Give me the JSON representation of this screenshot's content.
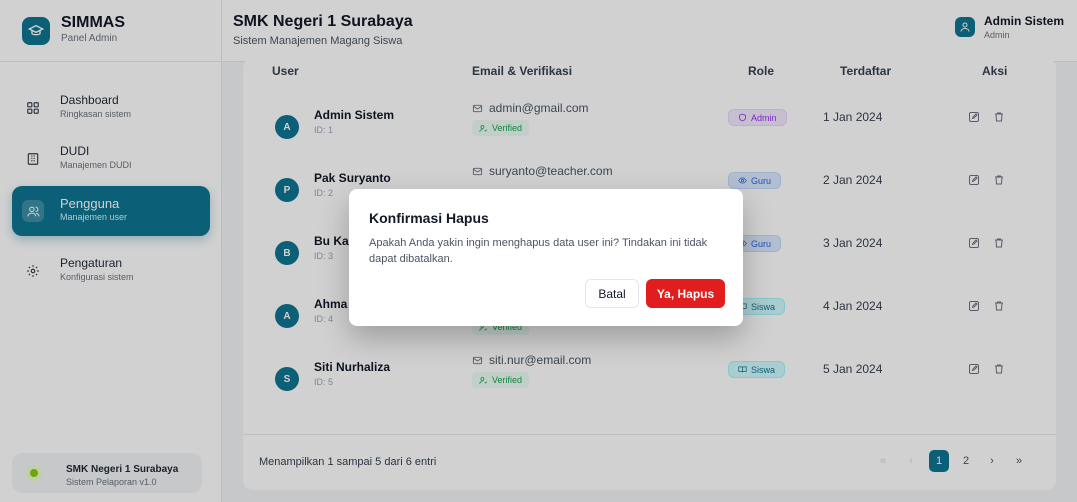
{
  "brand": {
    "title": "SIMMAS",
    "subtitle": "Panel Admin"
  },
  "sidebar": {
    "items": [
      {
        "label": "Dashboard",
        "sub": "Ringkasan sistem",
        "icon": "grid-icon"
      },
      {
        "label": "DUDI",
        "sub": "Manajemen DUDI",
        "icon": "building-icon"
      },
      {
        "label": "Pengguna",
        "sub": "Manajemen user",
        "icon": "users-icon"
      },
      {
        "label": "Pengaturan",
        "sub": "Konfigurasi sistem",
        "icon": "gear-icon"
      }
    ],
    "footer": {
      "title": "SMK Negeri 1 Surabaya",
      "subtitle": "Sistem Pelaporan v1.0"
    }
  },
  "header": {
    "title": "SMK Negeri 1 Surabaya",
    "subtitle": "Sistem Manajemen Magang Siswa",
    "user_name": "Admin Sistem",
    "user_role": "Admin"
  },
  "table": {
    "headers": {
      "user": "User",
      "email": "Email & Verifikasi",
      "role": "Role",
      "registered": "Terdaftar",
      "actions": "Aksi"
    },
    "rows": [
      {
        "initial": "A",
        "name": "Admin Sistem",
        "id": "ID: 1",
        "email": "admin@gmail.com",
        "verified": "Verified",
        "role": "Admin",
        "date": "1 Jan 2024"
      },
      {
        "initial": "P",
        "name": "Pak Suryanto",
        "id": "ID: 2",
        "email": "suryanto@teacher.com",
        "verified": "",
        "role": "Guru",
        "date": "2 Jan 2024"
      },
      {
        "initial": "B",
        "name": "Bu Kar",
        "id": "ID: 3",
        "email": "",
        "verified": "",
        "role": "Guru",
        "date": "3 Jan 2024"
      },
      {
        "initial": "A",
        "name": "Ahma",
        "id": "ID: 4",
        "email": "",
        "verified": "Verified",
        "role": "Siswa",
        "date": "4 Jan 2024"
      },
      {
        "initial": "S",
        "name": "Siti Nurhaliza",
        "id": "ID: 5",
        "email": "siti.nur@email.com",
        "verified": "Verified",
        "role": "Siswa",
        "date": "5 Jan 2024"
      }
    ],
    "footer_text": "Menampilkan 1 sampai 5 dari 6 entri",
    "pagination": {
      "first": "«",
      "prev": "‹",
      "pages": [
        "1",
        "2"
      ],
      "next": "›",
      "last": "»"
    }
  },
  "modal": {
    "title": "Konfirmasi Hapus",
    "message": "Apakah Anda yakin ingin menghapus data user ini? Tindakan ini tidak dapat dibatalkan.",
    "cancel_label": "Batal",
    "confirm_label": "Ya, Hapus"
  },
  "colors": {
    "accent": "#0e7490",
    "danger": "#e11d1d",
    "admin_badge": "#9333ea",
    "guru_badge": "#2563eb",
    "verified": "#16a34a"
  }
}
